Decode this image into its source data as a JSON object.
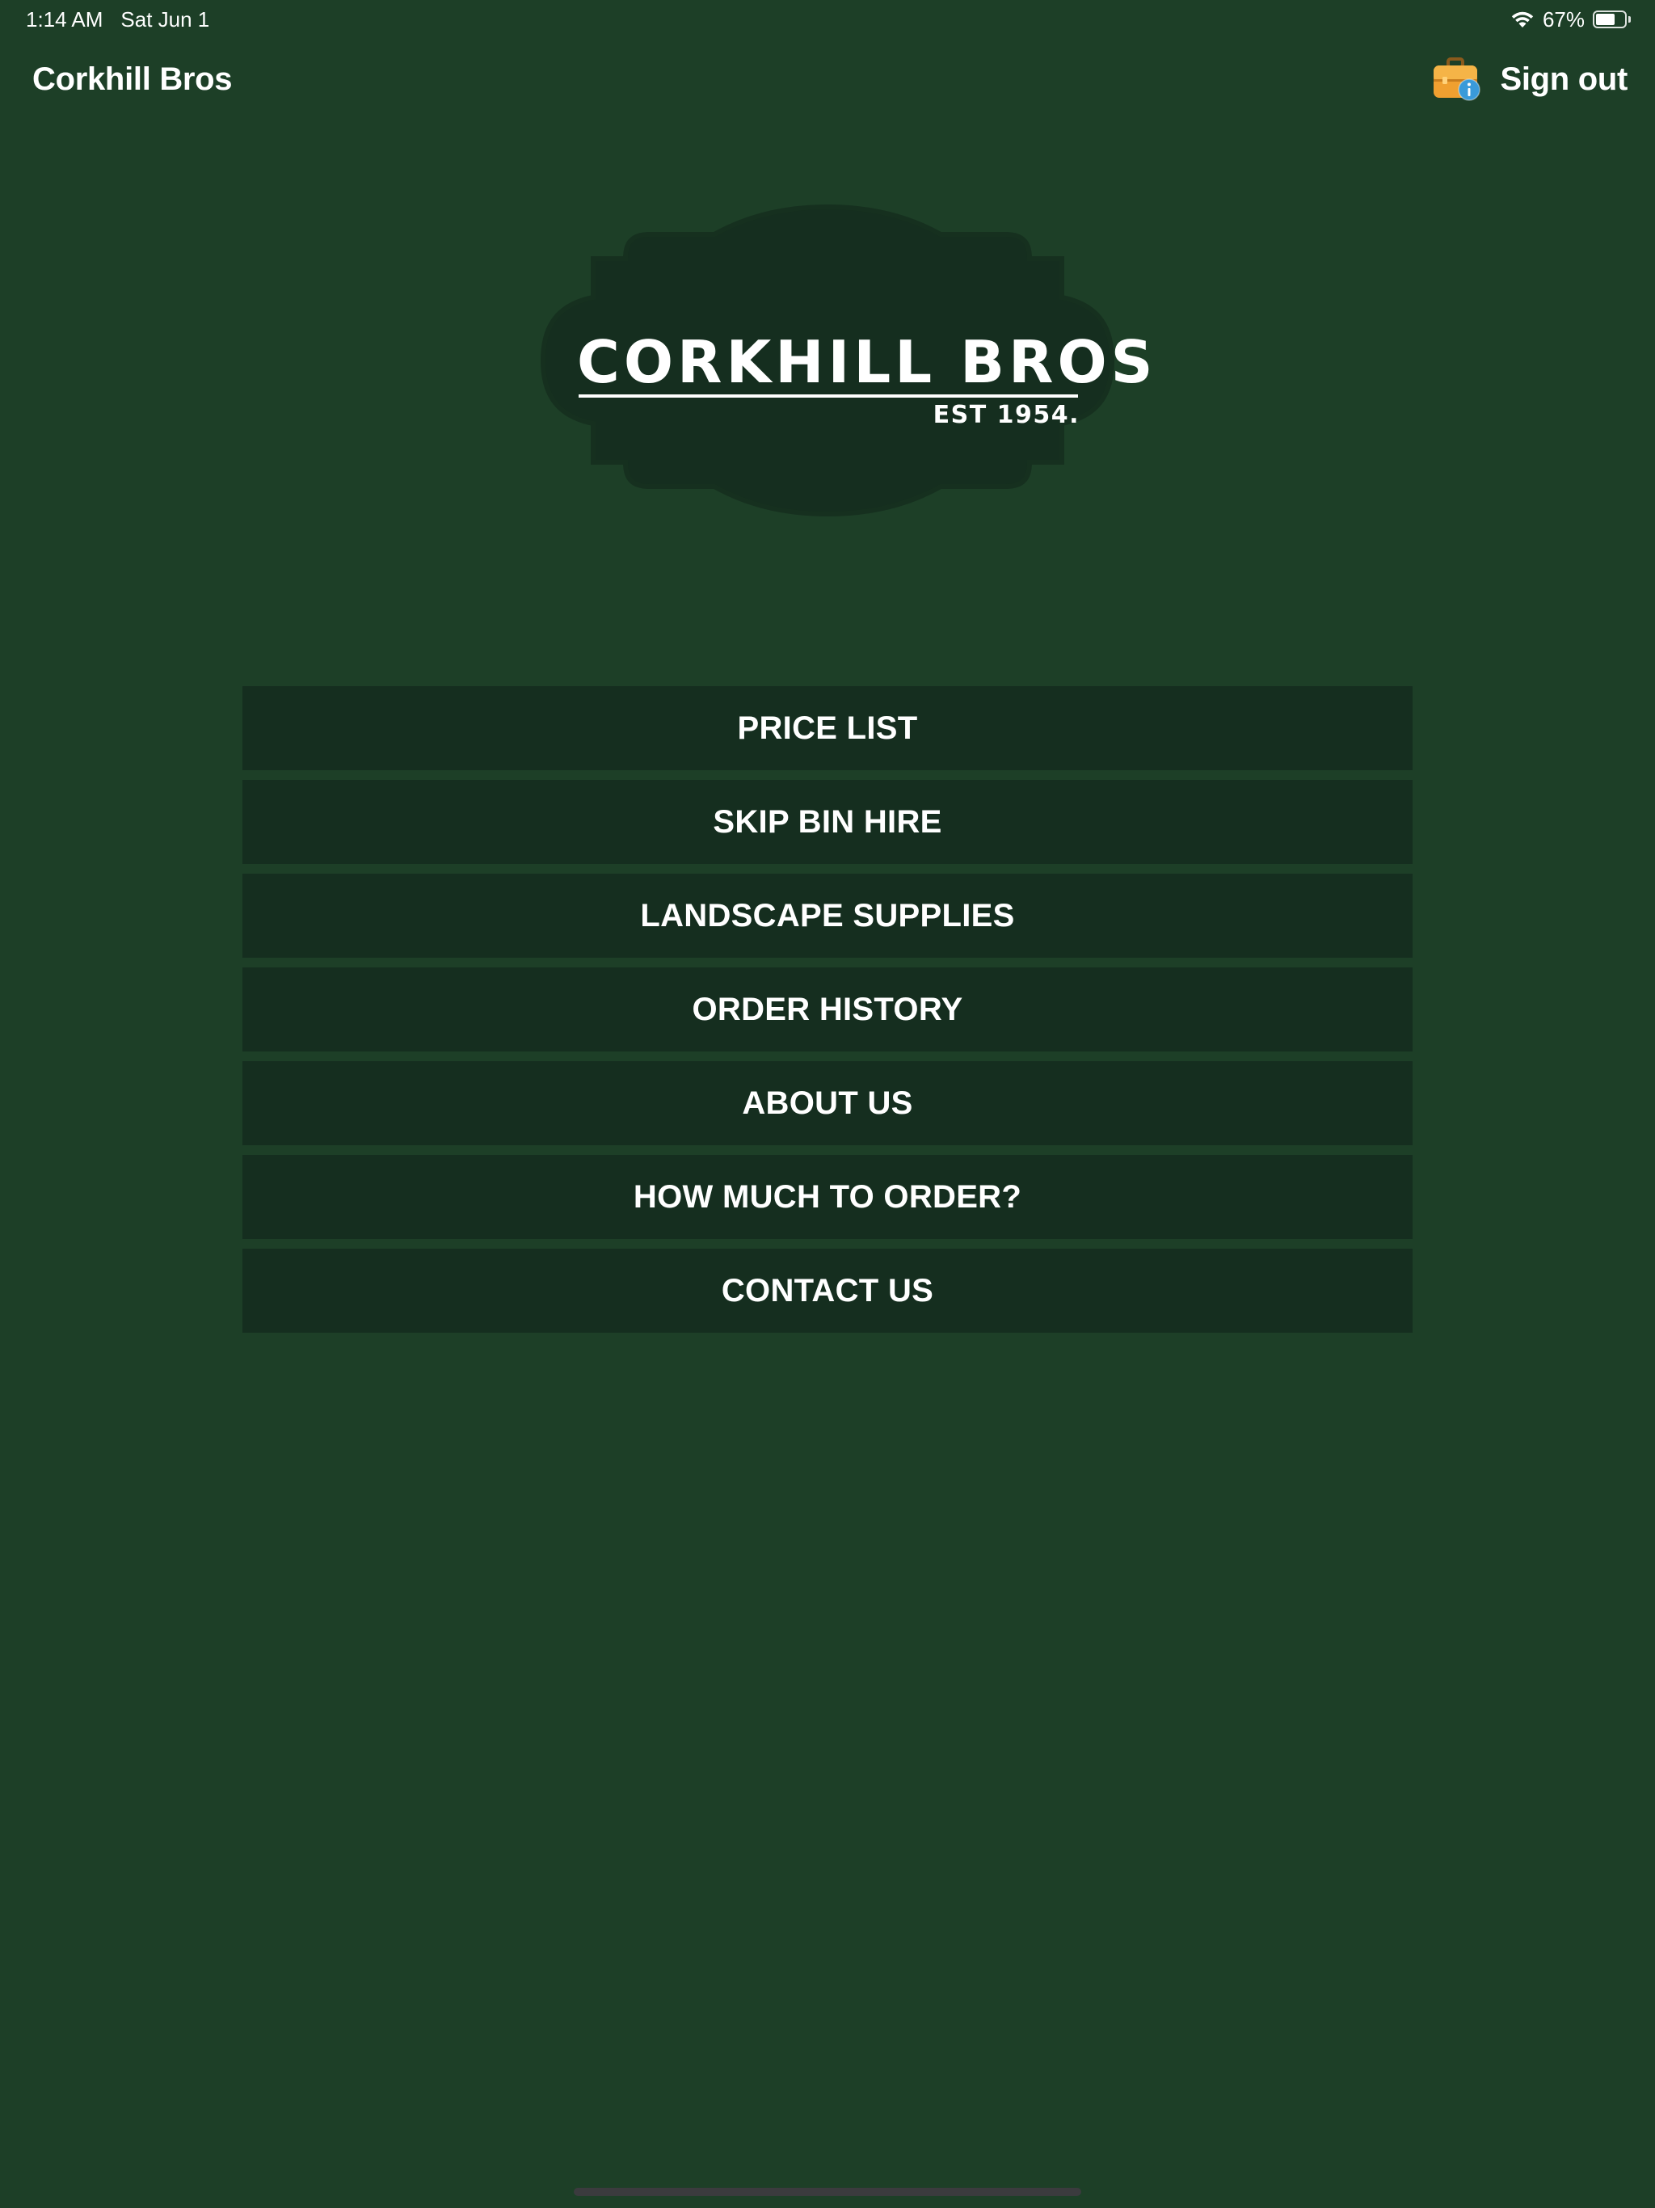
{
  "status_bar": {
    "time": "1:14 AM",
    "date": "Sat Jun 1",
    "battery_percent_label": "67%",
    "battery_level": 0.67,
    "wifi_icon": "wifi-icon",
    "battery_icon": "battery-icon"
  },
  "nav": {
    "title": "Corkhill Bros",
    "info_icon": "briefcase-info-icon",
    "sign_out_label": "Sign out"
  },
  "logo": {
    "wordmark": "CORKHILL BROS",
    "established": "EST 1954."
  },
  "menu": {
    "items": [
      {
        "label": "PRICE LIST"
      },
      {
        "label": "SKIP BIN HIRE"
      },
      {
        "label": "LANDSCAPE SUPPLIES"
      },
      {
        "label": "ORDER HISTORY"
      },
      {
        "label": "ABOUT US"
      },
      {
        "label": "HOW MUCH TO ORDER?"
      },
      {
        "label": "CONTACT US"
      }
    ]
  },
  "colors": {
    "background": "#1d3f27",
    "button_background": "#152e1f",
    "logo_badge": "#152e1f",
    "text": "#ffffff"
  }
}
